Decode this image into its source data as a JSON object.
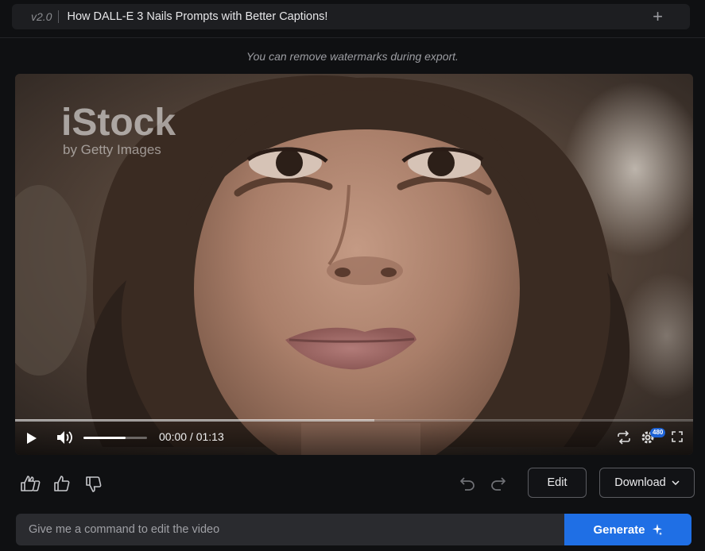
{
  "header": {
    "version": "v2.0",
    "title": "How DALL-E 3 Nails Prompts with Better Captions!",
    "add_icon": "plus-icon"
  },
  "notice": "You can remove watermarks during export.",
  "player": {
    "watermark_brand": "iStock",
    "watermark_sub": "by Getty Images",
    "time_display": "00:00 / 01:13",
    "quality_badge": "480",
    "progress_fraction": 0.0,
    "buffered_fraction": 0.53,
    "volume_fraction": 0.66,
    "icons": [
      "play-icon",
      "volume-icon",
      "loop-icon",
      "settings-icon",
      "fullscreen-icon"
    ]
  },
  "actions": {
    "icons": [
      "thumbs-up-double-icon",
      "thumbs-up-icon",
      "thumbs-down-icon",
      "undo-icon",
      "redo-icon"
    ],
    "edit_label": "Edit",
    "download_label": "Download"
  },
  "command": {
    "placeholder": "Give me a command to edit the video",
    "generate_label": "Generate"
  },
  "colors": {
    "background": "#0f1012",
    "accent": "#1f6fe5",
    "badge": "#1e63d6"
  }
}
